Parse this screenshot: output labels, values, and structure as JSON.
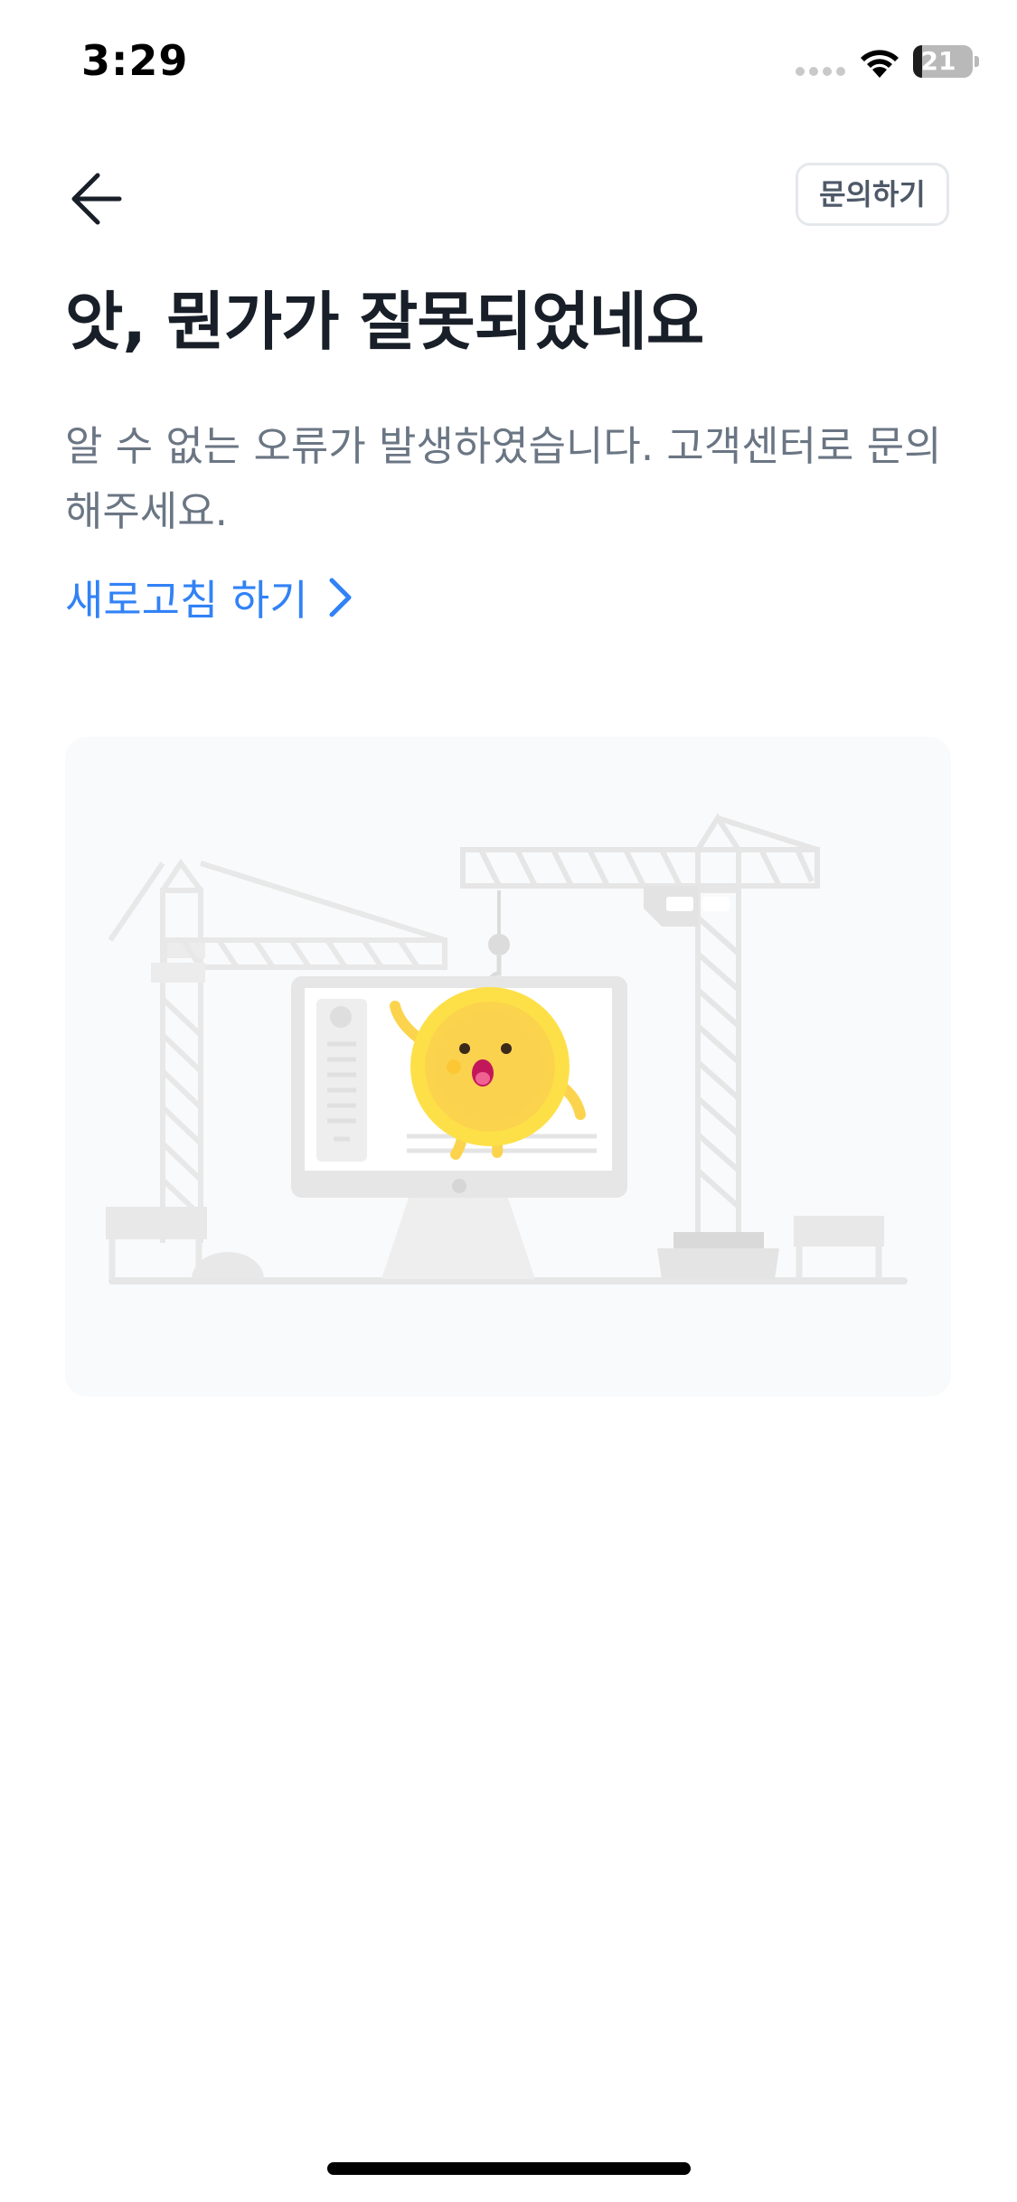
{
  "status_bar": {
    "time": "3:29",
    "battery": "21"
  },
  "header": {
    "contact_label": "문의하기"
  },
  "content": {
    "title": "앗, 뭔가가 잘못되었네요",
    "description": "알 수 없는 오류가 발생하였습니다. 고객센터로 문의해주세요.",
    "refresh_label": "새로고침 하기"
  },
  "colors": {
    "accent": "#3182f6",
    "title": "#191f28",
    "body_text": "#6b7684",
    "coin": "#fcd34d"
  },
  "icons": [
    "back-arrow-icon",
    "chevron-right-icon",
    "wifi-icon",
    "battery-icon",
    "cellular-icon"
  ]
}
